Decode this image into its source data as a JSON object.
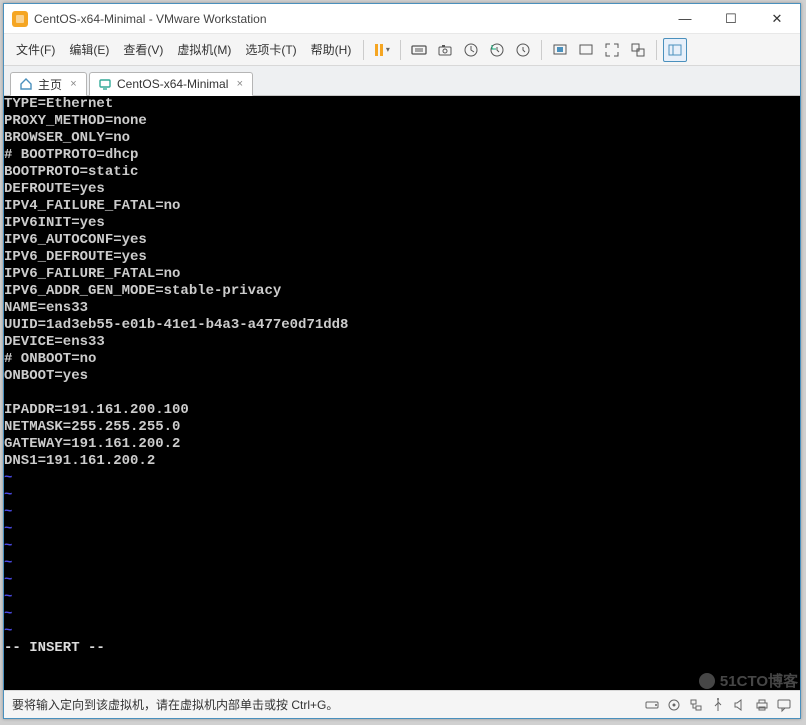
{
  "window": {
    "title": "CentOS-x64-Minimal - VMware Workstation"
  },
  "menu": {
    "items": [
      "文件(F)",
      "编辑(E)",
      "查看(V)",
      "虚拟机(M)",
      "选项卡(T)",
      "帮助(H)"
    ]
  },
  "tabs": {
    "home": "主页",
    "vm": "CentOS-x64-Minimal"
  },
  "terminal": {
    "lines": [
      "TYPE=Ethernet",
      "PROXY_METHOD=none",
      "BROWSER_ONLY=no",
      "# BOOTPROTO=dhcp",
      "BOOTPROTO=static",
      "DEFROUTE=yes",
      "IPV4_FAILURE_FATAL=no",
      "IPV6INIT=yes",
      "IPV6_AUTOCONF=yes",
      "IPV6_DEFROUTE=yes",
      "IPV6_FAILURE_FATAL=no",
      "IPV6_ADDR_GEN_MODE=stable-privacy",
      "NAME=ens33",
      "UUID=1ad3eb55-e01b-41e1-b4a3-a477e0d71dd8",
      "DEVICE=ens33",
      "# ONBOOT=no",
      "ONBOOT=yes",
      "",
      "IPADDR=191.161.200.100",
      "NETMASK=255.255.255.0",
      "GATEWAY=191.161.200.2",
      "DNS1=191.161.200.2"
    ],
    "mode_line": "-- INSERT --"
  },
  "statusbar": {
    "hint": "要将输入定向到该虚拟机，请在虚拟机内部单击或按 Ctrl+G。"
  },
  "watermark": "51CTO博客"
}
